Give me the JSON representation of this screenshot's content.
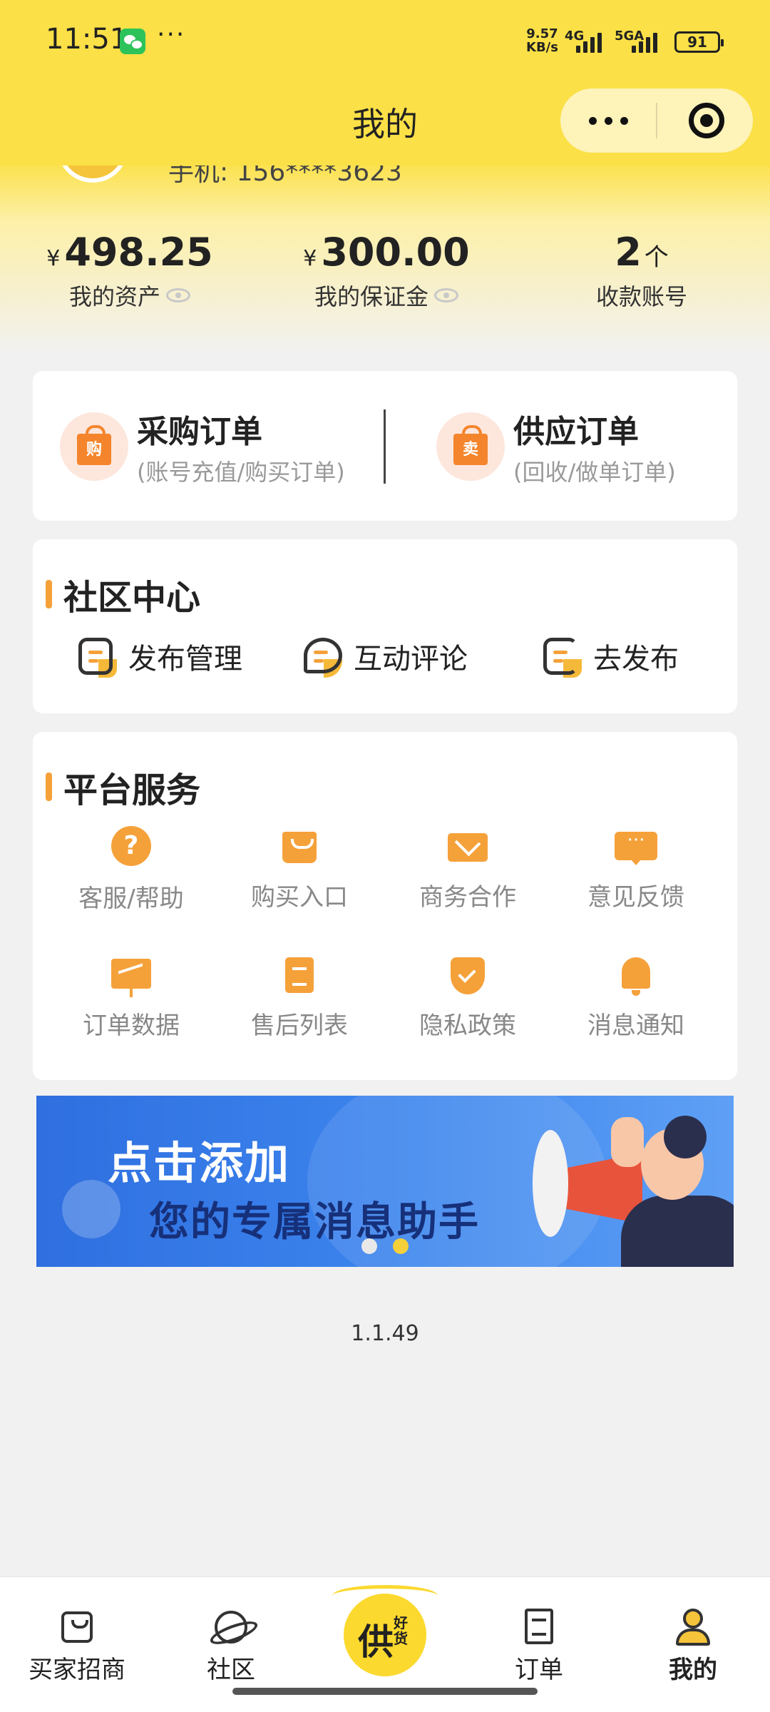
{
  "status_bar": {
    "time": "11:51",
    "more": "···",
    "net_speed_value": "9.57",
    "net_speed_unit": "KB/s",
    "net1": "4G",
    "net2": "5GA",
    "battery": "91"
  },
  "header": {
    "title": "我的",
    "capsule_more_icon": "more-dots-icon",
    "capsule_close_icon": "target-icon"
  },
  "profile": {
    "phone_text": "手机: 156****3623"
  },
  "stats": [
    {
      "currency": "¥",
      "value": "498.25",
      "unit": "",
      "label": "我的资产",
      "eye_icon": true
    },
    {
      "currency": "¥",
      "value": "300.00",
      "unit": "",
      "label": "我的保证金",
      "eye_icon": true
    },
    {
      "currency": "",
      "value": "2",
      "unit": "个",
      "label": "收款账号",
      "eye_icon": false
    }
  ],
  "orders": {
    "purchase": {
      "title": "采购订单",
      "subtitle": "(账号充值/购买订单)",
      "icon_char": "购"
    },
    "supply": {
      "title": "供应订单",
      "subtitle": "(回收/做单订单)",
      "icon_char": "卖"
    }
  },
  "community": {
    "title": "社区中心",
    "items": [
      {
        "label": "发布管理",
        "icon": "publish-manage-icon"
      },
      {
        "label": "互动评论",
        "icon": "comment-icon"
      },
      {
        "label": "去发布",
        "icon": "edit-icon"
      }
    ]
  },
  "services": {
    "title": "平台服务",
    "items": [
      {
        "label": "客服/帮助",
        "icon": "help-icon",
        "glyph": "?"
      },
      {
        "label": "购买入口",
        "icon": "shopping-bag-icon"
      },
      {
        "label": "商务合作",
        "icon": "mail-icon"
      },
      {
        "label": "意见反馈",
        "icon": "chat-icon",
        "glyph": "···"
      },
      {
        "label": "订单数据",
        "icon": "chart-board-icon"
      },
      {
        "label": "售后列表",
        "icon": "document-icon"
      },
      {
        "label": "隐私政策",
        "icon": "shield-icon"
      },
      {
        "label": "消息通知",
        "icon": "bell-icon"
      }
    ]
  },
  "banner": {
    "line1": "点击添加",
    "line2": "您的专属消息助手",
    "active_slide": 2,
    "slide_count": 2
  },
  "version": "1.1.49",
  "tabbar": {
    "items": [
      {
        "label": "买家招商",
        "icon": "store-icon",
        "active": false
      },
      {
        "label": "社区",
        "icon": "planet-icon",
        "active": false
      },
      {
        "label": "订单",
        "icon": "order-doc-icon",
        "active": false
      },
      {
        "label": "我的",
        "icon": "user-icon",
        "active": true
      }
    ],
    "center": {
      "main": "供",
      "sub": "好货"
    }
  },
  "colors": {
    "header_yellow": "#fbe047",
    "accent_orange": "#f5a13a",
    "banner_blue": "#2f6fe0"
  }
}
